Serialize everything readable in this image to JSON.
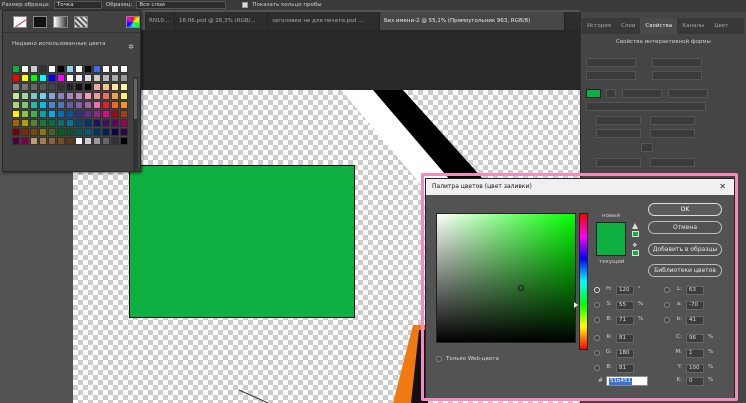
{
  "options_bar": {
    "sample_size_label": "Размер образца:",
    "sample_size_value": "Точка",
    "sample_label": "Образец:",
    "sample_value": "Все слои",
    "show_ring_label": "Показать кольцо пробы"
  },
  "tabs": [
    {
      "label": "RN10..."
    },
    {
      "label": "16.06.psd @ 26,3% (RGB/..."
    },
    {
      "label": "заголовки не для печати.psd ..."
    },
    {
      "label": "Без имени-2 @ 55,1% (Прямоугольник 963, RGB/8)",
      "active": true
    }
  ],
  "swatches": {
    "recent_label": "Недавно использованные цвета",
    "colors": [
      "#0fb042",
      "#ffffff",
      "#cccccc",
      "#333333",
      "#ffffff",
      "#000000",
      "#8fd1f0",
      "#ffffff",
      "#000000",
      "#3a6ee8",
      "#ffffff",
      "#ffffff",
      "#ffffff",
      "#ff0000",
      "#ffff00",
      "#00ff00",
      "#00ffff",
      "#0000ff",
      "#ff00ff",
      "#ffffff",
      "#eeeeee",
      "#dddddd",
      "#cccccc",
      "#bbbbbb",
      "#aaaaaa",
      "#999999",
      "#888888",
      "#777777",
      "#666666",
      "#555555",
      "#444444",
      "#333333",
      "#222222",
      "#111111",
      "#000000",
      "#f2a89a",
      "#f7c48d",
      "#fde89b",
      "#fff5a3",
      "#c7e1a0",
      "#a3d39c",
      "#7bcdc2",
      "#6dcff6",
      "#7da7d9",
      "#8781bd",
      "#a186be",
      "#bd8cbf",
      "#f49ac1",
      "#f5989d",
      "#ef6b5c",
      "#f6a04d",
      "#fff467",
      "#acd372",
      "#7dc473",
      "#1cbbb4",
      "#00bff3",
      "#438ccb",
      "#5574b9",
      "#605ca8",
      "#855fa8",
      "#a763a8",
      "#f06ea9",
      "#ed1c24",
      "#f26522",
      "#f7941d",
      "#fff200",
      "#8dc63f",
      "#39b54a",
      "#00a99d",
      "#00aeef",
      "#0072bc",
      "#0054a6",
      "#2e3192",
      "#662d91",
      "#92278f",
      "#ec008c",
      "#9e0b0f",
      "#a0410d",
      "#a36209",
      "#aba000",
      "#598527",
      "#197b30",
      "#007236",
      "#00746b",
      "#0076a3",
      "#004a80",
      "#003471",
      "#1b1464",
      "#440e62",
      "#630460",
      "#9e005d",
      "#790000",
      "#7b2e00",
      "#7d4900",
      "#827b00",
      "#406618",
      "#005e20",
      "#005826",
      "#005952",
      "#005b7f",
      "#003663",
      "#002157",
      "#0d004c",
      "#32004b",
      "#4b0049",
      "#7b0046",
      "#c69c6d",
      "#a67c52",
      "#8c6239",
      "#754c24",
      "#603913",
      "#ffffff",
      "#cccccc",
      "#999999",
      "#666666",
      "#333333",
      "#000000"
    ]
  },
  "right_panel": {
    "tabs": [
      {
        "label": "История"
      },
      {
        "label": "Слои"
      },
      {
        "label": "Свойства",
        "active": true
      },
      {
        "label": "Каналы"
      },
      {
        "label": "Цвет"
      }
    ],
    "properties_title": "Свойства интерактивной формы"
  },
  "dialog": {
    "title": "Палитра цветов (цвет заливки)",
    "new_label": "новый",
    "current_label": "текущий",
    "buttons": {
      "ok": "OK",
      "cancel": "Отмена",
      "add_to_swatches": "Добавить в образцы",
      "color_libraries": "Библиотеки цветов"
    },
    "web_only_label": "Только Web-цвета",
    "values": {
      "H": "120",
      "S": "55",
      "B": "71",
      "R": "81",
      "G": "180",
      "Bb": "81",
      "L": "63",
      "a": "-70",
      "b": "41",
      "C": "96",
      "M": "1",
      "Y": "100",
      "K": "0"
    },
    "units": {
      "deg": "°",
      "pct": "%"
    },
    "hex_label": "#",
    "hex_value": "51b451"
  },
  "colors": {
    "fill_green": "#0fb042",
    "highlight": "#f48cc0"
  }
}
